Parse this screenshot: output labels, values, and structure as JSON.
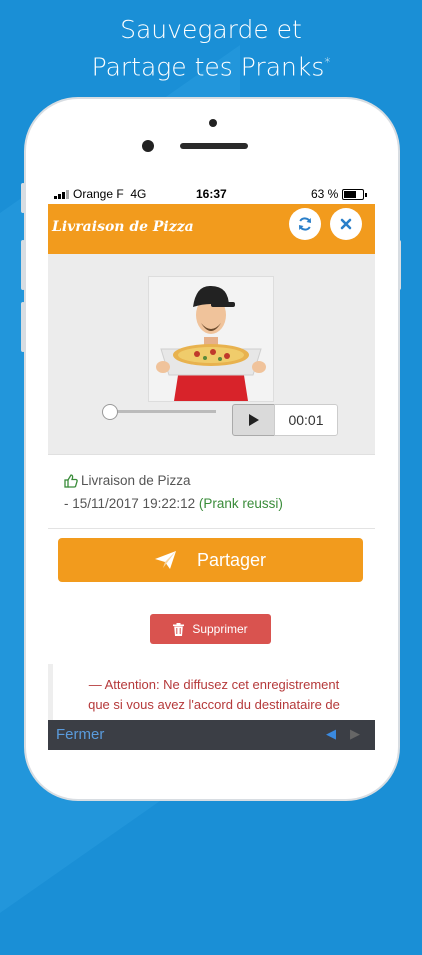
{
  "promo": {
    "line1": "Sauvegarde et",
    "line2": "Partage tes Pranks",
    "asterisk": "*"
  },
  "status_bar": {
    "carrier": "Orange F",
    "network": "4G",
    "time": "16:37",
    "battery": "63 %"
  },
  "header": {
    "title": "Livraison de Pizza",
    "refresh_icon": "refresh-icon",
    "close_icon": "close-icon"
  },
  "player": {
    "image_icon": "pizza-delivery-photo",
    "progress": 0.0,
    "play_icon": "play-icon",
    "elapsed": "00:01"
  },
  "recording": {
    "name": "Livraison de Pizza",
    "date_prefix": "- 15/11/2017 19:22:12",
    "status": "(Prank reussi)",
    "thumb_icon": "thumbs-up-icon"
  },
  "actions": {
    "share_label": "Partager",
    "delete_label": "Supprimer"
  },
  "warning": {
    "line1": "— Attention: Ne diffusez cet enregistrement",
    "line2": "que si vous avez l'accord du destinataire de"
  },
  "footer": {
    "close_label": "Fermer",
    "prev_icon": "arrow-left-icon",
    "next_icon": "arrow-right-icon"
  },
  "colors": {
    "background": "#1a8fd6",
    "accent": "#f29b1d",
    "danger": "#d9534f",
    "success": "#3a8c3a",
    "warning_text": "#b5393a"
  }
}
